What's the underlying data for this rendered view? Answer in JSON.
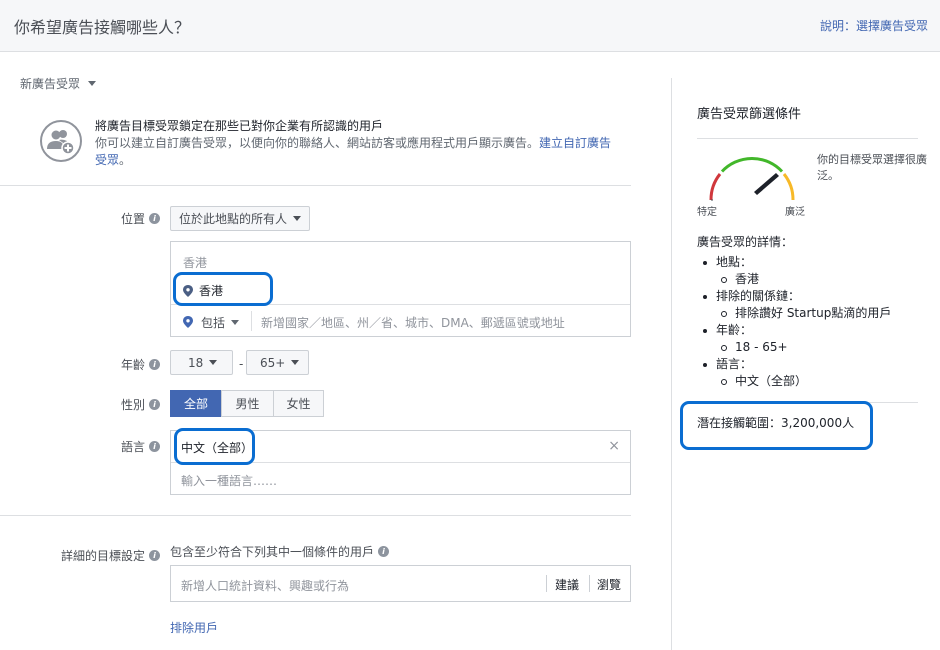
{
  "header": {
    "title": "你希望廣告接觸哪些人？",
    "help_label": "說明：選擇廣告受眾"
  },
  "audience_dropdown": {
    "label": "新廣告受眾"
  },
  "custom_audience": {
    "title": "將廣告目標受眾鎖定在那些已對你企業有所認識的用戶",
    "description": "你可以建立自訂廣告受眾，以便向你的聯絡人、網站訪客或應用程式用戶顯示廣告。",
    "link_label": "建立自訂廣告受眾",
    "link_suffix": "。"
  },
  "location": {
    "label": "位置",
    "scope_value": "位於此地點的所有人",
    "region": "香港",
    "selected": "香港",
    "include_label": "包括",
    "placeholder": "新增國家／地區、州／省、城市、DMA、郵遞區號或地址"
  },
  "age": {
    "label": "年齡",
    "min": "18",
    "max": "65+",
    "separator": "-"
  },
  "gender": {
    "label": "性別",
    "options": [
      "全部",
      "男性",
      "女性"
    ]
  },
  "language": {
    "label": "語言",
    "selected": "中文（全部）",
    "remove": "×",
    "placeholder": "輸入一種語言……"
  },
  "detailed_targeting": {
    "label": "詳細的目標設定",
    "subtitle": "包含至少符合下列其中一個條件的用戶",
    "placeholder": "新增人口統計資料、興趣或行為",
    "suggest_label": "建議",
    "browse_label": "瀏覽",
    "exclude_link": "排除用戶"
  },
  "right_panel": {
    "title": "廣告受眾篩選條件",
    "gauge_specific": "特定",
    "gauge_broad": "廣泛",
    "gauge_note": "你的目標受眾選擇很廣泛。",
    "details_title": "廣告受眾的詳情：",
    "items": [
      {
        "label": "地點：",
        "sub": "香港"
      },
      {
        "label": "排除的關係鏈：",
        "sub": "排除讚好 Startup點滴的用戶"
      },
      {
        "label": "年齡：",
        "sub": "18 - 65+"
      },
      {
        "label": "語言：",
        "sub": "中文（全部）"
      }
    ],
    "reach": "潛在接觸範圍：3,200,000人"
  },
  "colors": {
    "accent": "#4267b2",
    "highlight": "#0a6dd1",
    "gauge_red": "#d0373c",
    "gauge_green": "#42b72a",
    "gauge_orange": "#f7b928"
  }
}
